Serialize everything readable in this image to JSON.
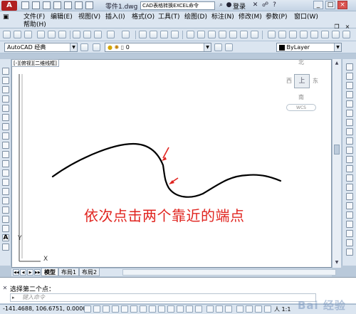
{
  "titlebar": {
    "app_logo": "A",
    "document": "零件1.dwg",
    "search": "CAD表格转换EXCEL命令",
    "login": "登录",
    "window_controls": [
      "_",
      "□",
      "×"
    ]
  },
  "menu": {
    "items": [
      "文件(F)",
      "编辑(E)",
      "视图(V)",
      "插入(I)",
      "格式(O)",
      "工具(T)",
      "绘图(D)",
      "标注(N)",
      "修改(M)",
      "参数(P)",
      "窗口(W)",
      "帮助(H)"
    ]
  },
  "toolbar": {
    "workspace": "AutoCAD 经典",
    "layer": "0",
    "linetype": "ByLayer"
  },
  "canvas": {
    "header": "[-][俯视][二维线框]",
    "annotation": "依次点击两个靠近的端点",
    "ucs_y": "Y",
    "ucs_x": "X",
    "viewcube": {
      "north": "北",
      "south": "南",
      "west": "西",
      "east": "东",
      "face": "上",
      "wcs": "WCS"
    },
    "curve_color": "#000000",
    "arrow_color": "#e0241f"
  },
  "tabs": {
    "items": [
      "模型",
      "布局1",
      "布局2"
    ],
    "active": "模型"
  },
  "command": {
    "history": "选择第二个点：",
    "input_placeholder": "键入命令"
  },
  "status": {
    "coords": "-141.4688,  106.6751, 0.0000",
    "scale": "人 1:1",
    "watermark": "Bai 经验"
  },
  "colors": {
    "chrome": "#dbe5f0",
    "annotation_red": "#e0241f"
  }
}
